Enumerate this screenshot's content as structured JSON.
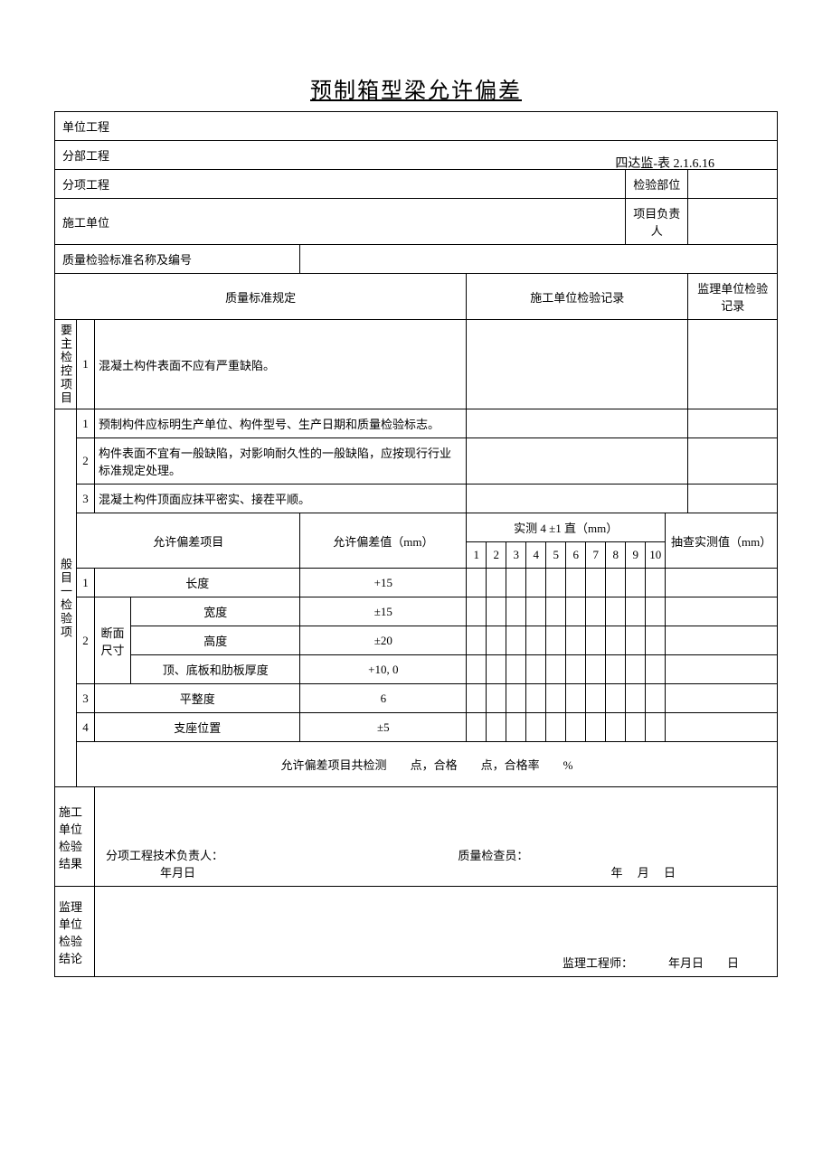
{
  "form_code": "四达监-表 2.1.6.16",
  "title": "预制箱型梁允许偏差",
  "labels": {
    "unit_project": "单位工程",
    "sub_project": "分部工程",
    "item_project": "分项工程",
    "inspection_part": "检验部位",
    "construction_unit": "施工单位",
    "project_leader": "项目负责人",
    "standard_name": "质量检验标准名称及编号",
    "quality_standard": "质量标准规定",
    "construction_record": "施工单位检验记录",
    "supervision_record": "监理单位检验记录",
    "main_section": "要主检控项目",
    "general_section": "般目一检验项",
    "tolerance_item": "允许偏差项目",
    "tolerance_value": "允许偏差值（mm）",
    "measured_header": "实测 4 ±1 直（mm）",
    "spot_check": "抽查实测值（mm）",
    "section_size": "断面尺寸",
    "summary_prefix": "允许偏差项目共检测",
    "summary_mid1": "点，合格",
    "summary_mid2": "点，合格率",
    "summary_suffix": "%",
    "construction_result": "施工单位检验结果",
    "tech_leader": "分项工程技术负责人：",
    "quality_inspector": "质量检查员：",
    "date_ymd": "年月日",
    "year": "年",
    "month": "月",
    "day": "日",
    "supervision_conclusion": "监理单位检验结论",
    "supervision_engineer": "监理工程师："
  },
  "main_items": [
    {
      "no": "1",
      "desc": "混凝土构件表面不应有严重缺陷。"
    }
  ],
  "general_text_items": [
    {
      "no": "1",
      "desc": "预制构件应标明生产单位、构件型号、生产日期和质量检验标志。"
    },
    {
      "no": "2",
      "desc": "构件表面不宜有一般缺陷，对影响耐久性的一般缺陷，应按现行行业标准规定处理。"
    },
    {
      "no": "3",
      "desc": "混凝土构件顶面应抹平密实、接茬平顺。"
    }
  ],
  "col_nums": [
    "1",
    "2",
    "3",
    "4",
    "5",
    "6",
    "7",
    "8",
    "9",
    "10"
  ],
  "tolerance_rows": [
    {
      "no": "1",
      "name": "长度",
      "value": "+15",
      "group": null
    },
    {
      "no": "2",
      "name": "宽度",
      "value": "±15",
      "group": "section"
    },
    {
      "no": "",
      "name": "高度",
      "value": "±20",
      "group": "section"
    },
    {
      "no": "",
      "name": "顶、底板和肋板厚度",
      "value": "+10, 0",
      "group": "section"
    },
    {
      "no": "3",
      "name": "平整度",
      "value": "6",
      "group": null
    },
    {
      "no": "4",
      "name": "支座位置",
      "value": "±5",
      "group": null
    }
  ]
}
